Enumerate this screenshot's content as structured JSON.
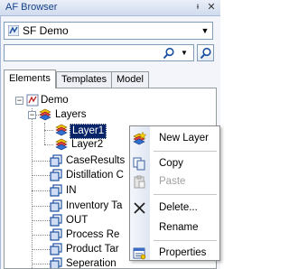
{
  "window": {
    "title": "AF Browser",
    "pin_icon": "pin-icon",
    "close_icon": "close-icon"
  },
  "database": {
    "selected": "SF Demo",
    "icon": "database-icon"
  },
  "search": {
    "value": "",
    "icon": "magnifier-icon"
  },
  "tabs": [
    {
      "label": "Elements",
      "active": true
    },
    {
      "label": "Templates",
      "active": false
    },
    {
      "label": "Model",
      "active": false
    }
  ],
  "tree": {
    "root": "Demo",
    "layers": {
      "label": "Layers",
      "children": [
        "Layer1",
        "Layer2"
      ],
      "selected": "Layer1"
    },
    "elements": [
      "CaseResults",
      "Distillation C",
      "IN",
      "Inventory Ta",
      "OUT",
      "Process Re",
      "Product Tar",
      "Seperation"
    ]
  },
  "context_menu": {
    "items": [
      {
        "label": "New Layer",
        "icon": "new-layer-icon",
        "enabled": true
      },
      {
        "label": "Copy",
        "icon": "copy-icon",
        "enabled": true
      },
      {
        "label": "Paste",
        "icon": "paste-icon",
        "enabled": false
      },
      {
        "label": "Delete...",
        "icon": "delete-icon",
        "enabled": true
      },
      {
        "label": "Rename",
        "icon": "",
        "enabled": true
      },
      {
        "label": "Properties",
        "icon": "properties-icon",
        "enabled": true
      }
    ]
  },
  "colors": {
    "selection": "#0a246a",
    "titlebar_text": "#15428b",
    "panel": "#f3f5fa"
  }
}
